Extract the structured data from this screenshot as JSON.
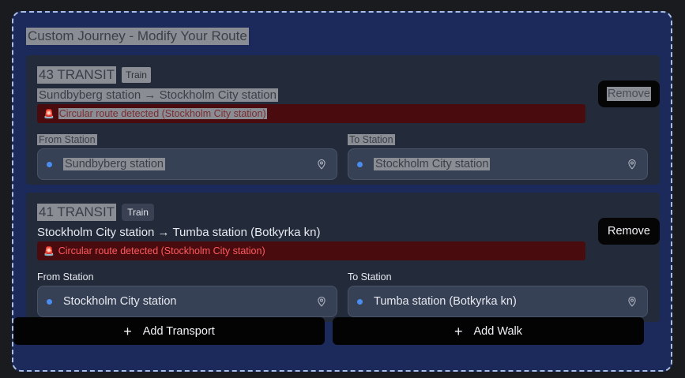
{
  "panel": {
    "title": "Custom Journey - Modify Your Route"
  },
  "legs": [
    {
      "title": "43 TRANSIT",
      "mode_badge": "Train",
      "route": "Sundbyberg station → Stockholm City station",
      "alert": "Circular route detected (Stockholm City station)",
      "remove_label": "Remove",
      "from_label": "From Station",
      "to_label": "To Station",
      "from_value": "Sundbyberg station",
      "to_value": "Stockholm City station",
      "selected": true
    },
    {
      "title": "41 TRANSIT",
      "mode_badge": "Train",
      "route": "Stockholm City station → Tumba station (Botkyrka kn)",
      "alert": "Circular route detected (Stockholm City station)",
      "remove_label": "Remove",
      "from_label": "From Station",
      "to_label": "To Station",
      "from_value": "Stockholm City station",
      "to_value": "Tumba station (Botkyrka kn)",
      "selected": false
    }
  ],
  "actions": {
    "add_transport_label": "Add Transport",
    "add_walk_label": "Add Walk"
  },
  "icons": {
    "alert": "siren-icon",
    "location": "map-pin-icon",
    "add": "plus-icon"
  },
  "colors": {
    "panel_bg": "#1b2a5a",
    "card_bg": "#232b3b",
    "alert_bg": "#4a0b0e",
    "alert_text": "#ff5a5f",
    "dot": "#4a8cf0"
  }
}
